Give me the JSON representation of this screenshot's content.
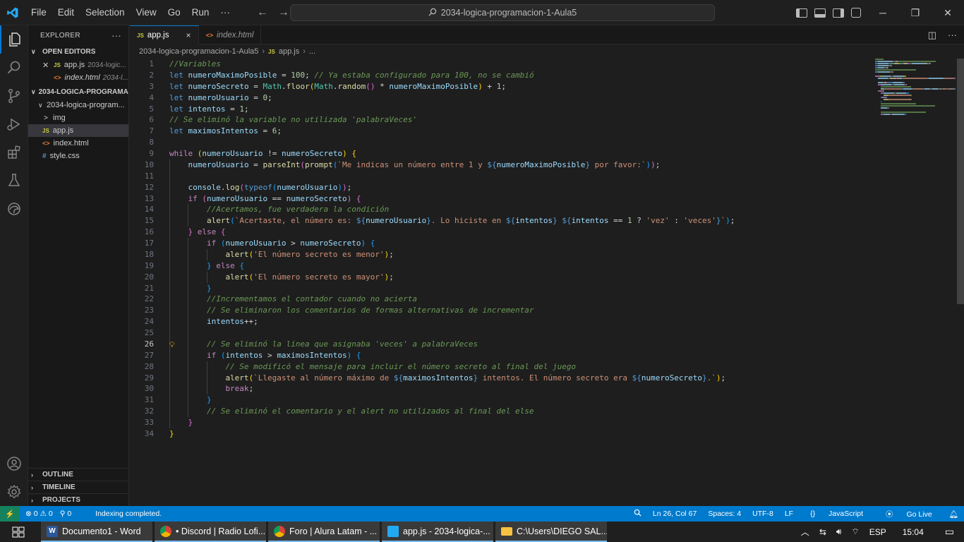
{
  "titlebar": {
    "menu": [
      "File",
      "Edit",
      "Selection",
      "View",
      "Go",
      "Run",
      "···"
    ],
    "search": "2034-logica-programacion-1-Aula5"
  },
  "sidebar": {
    "title": "EXPLORER",
    "more": "···",
    "open_editors_label": "OPEN EDITORS",
    "open_editors": [
      {
        "name": "app.js",
        "path": "2034-logic...",
        "badge": "JS"
      },
      {
        "name": "index.html",
        "path": "2034-l...",
        "badge": "<>"
      }
    ],
    "project_label": "2034-LOGICA-PROGRAMA...",
    "folder": "2034-logica-program...",
    "tree": [
      {
        "name": "img",
        "badge": ">"
      },
      {
        "name": "app.js",
        "badge": "JS"
      },
      {
        "name": "index.html",
        "badge": "<>"
      },
      {
        "name": "style.css",
        "badge": "#"
      }
    ],
    "outline": "OUTLINE",
    "timeline": "TIMELINE",
    "projects": "PROJECTS"
  },
  "tabs": [
    {
      "label": "app.js",
      "badge": "JS",
      "close": "×"
    },
    {
      "label": "index.html",
      "badge": "<>"
    }
  ],
  "breadcrumb": {
    "folder": "2034-logica-programacion-1-Aula5",
    "file_badge": "JS",
    "file": "app.js",
    "rest": "..."
  },
  "editor": {
    "current_line": 26,
    "lines": [
      {
        "n": 1,
        "indent": 0,
        "tokens": [
          [
            "c",
            "//Variables"
          ]
        ]
      },
      {
        "n": 2,
        "indent": 0,
        "tokens": [
          [
            "dk",
            "let "
          ],
          [
            "v",
            "numeroMaximoPosible"
          ],
          [
            "o",
            " = "
          ],
          [
            "n",
            "100"
          ],
          [
            "o",
            "; "
          ],
          [
            "c",
            "// Ya estaba configurado para 100, no se cambió"
          ]
        ]
      },
      {
        "n": 3,
        "indent": 0,
        "tokens": [
          [
            "dk",
            "let "
          ],
          [
            "v",
            "numeroSecreto"
          ],
          [
            "o",
            " = "
          ],
          [
            "t",
            "Math"
          ],
          [
            "o",
            "."
          ],
          [
            "f",
            "floor"
          ],
          [
            "b1",
            "("
          ],
          [
            "t",
            "Math"
          ],
          [
            "o",
            "."
          ],
          [
            "f",
            "random"
          ],
          [
            "b2",
            "()"
          ],
          [
            "o",
            " * "
          ],
          [
            "v",
            "numeroMaximoPosible"
          ],
          [
            "b1",
            ")"
          ],
          [
            "o",
            " + "
          ],
          [
            "n",
            "1"
          ],
          [
            "o",
            ";"
          ]
        ]
      },
      {
        "n": 4,
        "indent": 0,
        "tokens": [
          [
            "dk",
            "let "
          ],
          [
            "v",
            "numeroUsuario"
          ],
          [
            "o",
            " = "
          ],
          [
            "n",
            "0"
          ],
          [
            "o",
            ";"
          ]
        ]
      },
      {
        "n": 5,
        "indent": 0,
        "tokens": [
          [
            "dk",
            "let "
          ],
          [
            "v",
            "intentos"
          ],
          [
            "o",
            " = "
          ],
          [
            "n",
            "1"
          ],
          [
            "o",
            ";"
          ]
        ]
      },
      {
        "n": 6,
        "indent": 0,
        "tokens": [
          [
            "c",
            "// Se eliminó la variable no utilizada 'palabraVeces'"
          ]
        ]
      },
      {
        "n": 7,
        "indent": 0,
        "tokens": [
          [
            "dk",
            "let "
          ],
          [
            "v",
            "maximosIntentos"
          ],
          [
            "o",
            " = "
          ],
          [
            "n",
            "6"
          ],
          [
            "o",
            ";"
          ]
        ]
      },
      {
        "n": 8,
        "indent": 0,
        "tokens": []
      },
      {
        "n": 9,
        "indent": 0,
        "tokens": [
          [
            "kw",
            "while "
          ],
          [
            "b1",
            "("
          ],
          [
            "v",
            "numeroUsuario"
          ],
          [
            "o",
            " != "
          ],
          [
            "v",
            "numeroSecreto"
          ],
          [
            "b1",
            ")"
          ],
          [
            "o",
            " "
          ],
          [
            "b1",
            "{"
          ]
        ]
      },
      {
        "n": 10,
        "indent": 1,
        "tokens": [
          [
            "v",
            "numeroUsuario"
          ],
          [
            "o",
            " = "
          ],
          [
            "f",
            "parseInt"
          ],
          [
            "b2",
            "("
          ],
          [
            "f",
            "prompt"
          ],
          [
            "b3",
            "("
          ],
          [
            "s",
            "`Me indicas un número entre 1 y "
          ],
          [
            "i",
            "${"
          ],
          [
            "v",
            "numeroMaximoPosible"
          ],
          [
            "i",
            "}"
          ],
          [
            "s",
            " por favor:`"
          ],
          [
            "b3",
            ")"
          ],
          [
            "b2",
            ")"
          ],
          [
            "o",
            ";"
          ]
        ]
      },
      {
        "n": 11,
        "indent": 1,
        "tokens": []
      },
      {
        "n": 12,
        "indent": 1,
        "tokens": [
          [
            "v",
            "console"
          ],
          [
            "o",
            "."
          ],
          [
            "f",
            "log"
          ],
          [
            "b2",
            "("
          ],
          [
            "dk",
            "typeof"
          ],
          [
            "b3",
            "("
          ],
          [
            "v",
            "numeroUsuario"
          ],
          [
            "b3",
            ")"
          ],
          [
            "b2",
            ")"
          ],
          [
            "o",
            ";"
          ]
        ]
      },
      {
        "n": 13,
        "indent": 1,
        "tokens": [
          [
            "kw",
            "if "
          ],
          [
            "b2",
            "("
          ],
          [
            "v",
            "numeroUsuario"
          ],
          [
            "o",
            " == "
          ],
          [
            "v",
            "numeroSecreto"
          ],
          [
            "b2",
            ")"
          ],
          [
            "o",
            " "
          ],
          [
            "b2",
            "{"
          ]
        ]
      },
      {
        "n": 14,
        "indent": 2,
        "tokens": [
          [
            "c",
            "//Acertamos, fue verdadera la condición"
          ]
        ]
      },
      {
        "n": 15,
        "indent": 2,
        "tokens": [
          [
            "f",
            "alert"
          ],
          [
            "b3",
            "("
          ],
          [
            "s",
            "`Acertaste, el número es: "
          ],
          [
            "i",
            "${"
          ],
          [
            "v",
            "numeroUsuario"
          ],
          [
            "i",
            "}"
          ],
          [
            "s",
            ". Lo hiciste en "
          ],
          [
            "i",
            "${"
          ],
          [
            "v",
            "intentos"
          ],
          [
            "i",
            "}"
          ],
          [
            "s",
            " "
          ],
          [
            "i",
            "${"
          ],
          [
            "v",
            "intentos"
          ],
          [
            "o",
            " == "
          ],
          [
            "n",
            "1"
          ],
          [
            "o",
            " ? "
          ],
          [
            "s",
            "'vez'"
          ],
          [
            "o",
            " : "
          ],
          [
            "s",
            "'veces'"
          ],
          [
            "i",
            "}"
          ],
          [
            "s",
            "`"
          ],
          [
            "b3",
            ")"
          ],
          [
            "o",
            ";"
          ]
        ]
      },
      {
        "n": 16,
        "indent": 1,
        "tokens": [
          [
            "b2",
            "}"
          ],
          [
            "o",
            " "
          ],
          [
            "kw",
            "else "
          ],
          [
            "b2",
            "{"
          ]
        ]
      },
      {
        "n": 17,
        "indent": 2,
        "tokens": [
          [
            "kw",
            "if "
          ],
          [
            "b3",
            "("
          ],
          [
            "v",
            "numeroUsuario"
          ],
          [
            "o",
            " > "
          ],
          [
            "v",
            "numeroSecreto"
          ],
          [
            "b3",
            ")"
          ],
          [
            "o",
            " "
          ],
          [
            "b3",
            "{"
          ]
        ]
      },
      {
        "n": 18,
        "indent": 3,
        "tokens": [
          [
            "f",
            "alert"
          ],
          [
            "b1",
            "("
          ],
          [
            "s",
            "'El número secreto es menor'"
          ],
          [
            "b1",
            ")"
          ],
          [
            "o",
            ";"
          ]
        ]
      },
      {
        "n": 19,
        "indent": 2,
        "tokens": [
          [
            "b3",
            "}"
          ],
          [
            "o",
            " "
          ],
          [
            "kw",
            "else "
          ],
          [
            "b3",
            "{"
          ]
        ]
      },
      {
        "n": 20,
        "indent": 3,
        "tokens": [
          [
            "f",
            "alert"
          ],
          [
            "b1",
            "("
          ],
          [
            "s",
            "'El número secreto es mayor'"
          ],
          [
            "b1",
            ")"
          ],
          [
            "o",
            ";"
          ]
        ]
      },
      {
        "n": 21,
        "indent": 2,
        "tokens": [
          [
            "b3",
            "}"
          ]
        ]
      },
      {
        "n": 22,
        "indent": 2,
        "tokens": [
          [
            "c",
            "//Incrementamos el contador cuando no acierta"
          ]
        ]
      },
      {
        "n": 23,
        "indent": 2,
        "tokens": [
          [
            "c",
            "// Se eliminaron los comentarios de formas alternativas de incrementar"
          ]
        ]
      },
      {
        "n": 24,
        "indent": 2,
        "tokens": [
          [
            "v",
            "intentos"
          ],
          [
            "o",
            "++;"
          ]
        ]
      },
      {
        "n": 25,
        "indent": 2,
        "tokens": []
      },
      {
        "n": 26,
        "indent": 2,
        "bulb": true,
        "tokens": [
          [
            "c",
            "// Se eliminó la línea que asignaba 'veces' a palabraVeces"
          ]
        ]
      },
      {
        "n": 27,
        "indent": 2,
        "tokens": [
          [
            "kw",
            "if "
          ],
          [
            "b3",
            "("
          ],
          [
            "v",
            "intentos"
          ],
          [
            "o",
            " > "
          ],
          [
            "v",
            "maximosIntentos"
          ],
          [
            "b3",
            ")"
          ],
          [
            "o",
            " "
          ],
          [
            "b3",
            "{"
          ]
        ]
      },
      {
        "n": 28,
        "indent": 3,
        "tokens": [
          [
            "c",
            "// Se modificó el mensaje para incluir el número secreto al final del juego"
          ]
        ]
      },
      {
        "n": 29,
        "indent": 3,
        "tokens": [
          [
            "f",
            "alert"
          ],
          [
            "b1",
            "("
          ],
          [
            "s",
            "`Llegaste al número máximo de "
          ],
          [
            "i",
            "${"
          ],
          [
            "v",
            "maximosIntentos"
          ],
          [
            "i",
            "}"
          ],
          [
            "s",
            " intentos. El número secreto era "
          ],
          [
            "i",
            "${"
          ],
          [
            "v",
            "numeroSecreto"
          ],
          [
            "i",
            "}"
          ],
          [
            "s",
            ".`"
          ],
          [
            "b1",
            ")"
          ],
          [
            "o",
            ";"
          ]
        ]
      },
      {
        "n": 30,
        "indent": 3,
        "tokens": [
          [
            "kw",
            "break"
          ],
          [
            "o",
            ";"
          ]
        ]
      },
      {
        "n": 31,
        "indent": 2,
        "tokens": [
          [
            "b3",
            "}"
          ]
        ]
      },
      {
        "n": 32,
        "indent": 2,
        "tokens": [
          [
            "c",
            "// Se eliminó el comentario y el alert no utilizados al final del else"
          ]
        ]
      },
      {
        "n": 33,
        "indent": 1,
        "tokens": [
          [
            "b2",
            "}"
          ]
        ]
      },
      {
        "n": 34,
        "indent": 0,
        "tokens": [
          [
            "b1",
            "}"
          ]
        ]
      }
    ]
  },
  "statusbar": {
    "errors": "0",
    "warnings": "0",
    "ports": "0",
    "message": "Indexing completed.",
    "position": "Ln 26, Col 67",
    "spaces": "Spaces: 4",
    "encoding": "UTF-8",
    "eol": "LF",
    "language": "JavaScript",
    "golive": "Go Live"
  },
  "taskbar": {
    "apps": [
      {
        "label": "Documento1 - Word",
        "icon": "word-icon",
        "color": "#2b579a",
        "glyph": "W"
      },
      {
        "label": "• Discord | Radio Lofi...",
        "icon": "chrome-icon",
        "color": "#ffffff",
        "glyph": ""
      },
      {
        "label": "Foro | Alura Latam - ...",
        "icon": "chrome-icon",
        "color": "#ffffff",
        "glyph": ""
      },
      {
        "label": "app.js - 2034-logica-...",
        "icon": "vscode-icon",
        "color": "#23a9f2",
        "glyph": ""
      },
      {
        "label": "C:\\Users\\DIEGO SAL...",
        "icon": "folder-icon",
        "color": "#f5c242",
        "glyph": ""
      }
    ],
    "lang": "ESP",
    "time": "15:04"
  },
  "colors": {
    "accent": "#007acc",
    "activity_bg": "#1f1f1f",
    "sidebar_bg": "#181818",
    "editor_bg": "#1e1e1e"
  }
}
